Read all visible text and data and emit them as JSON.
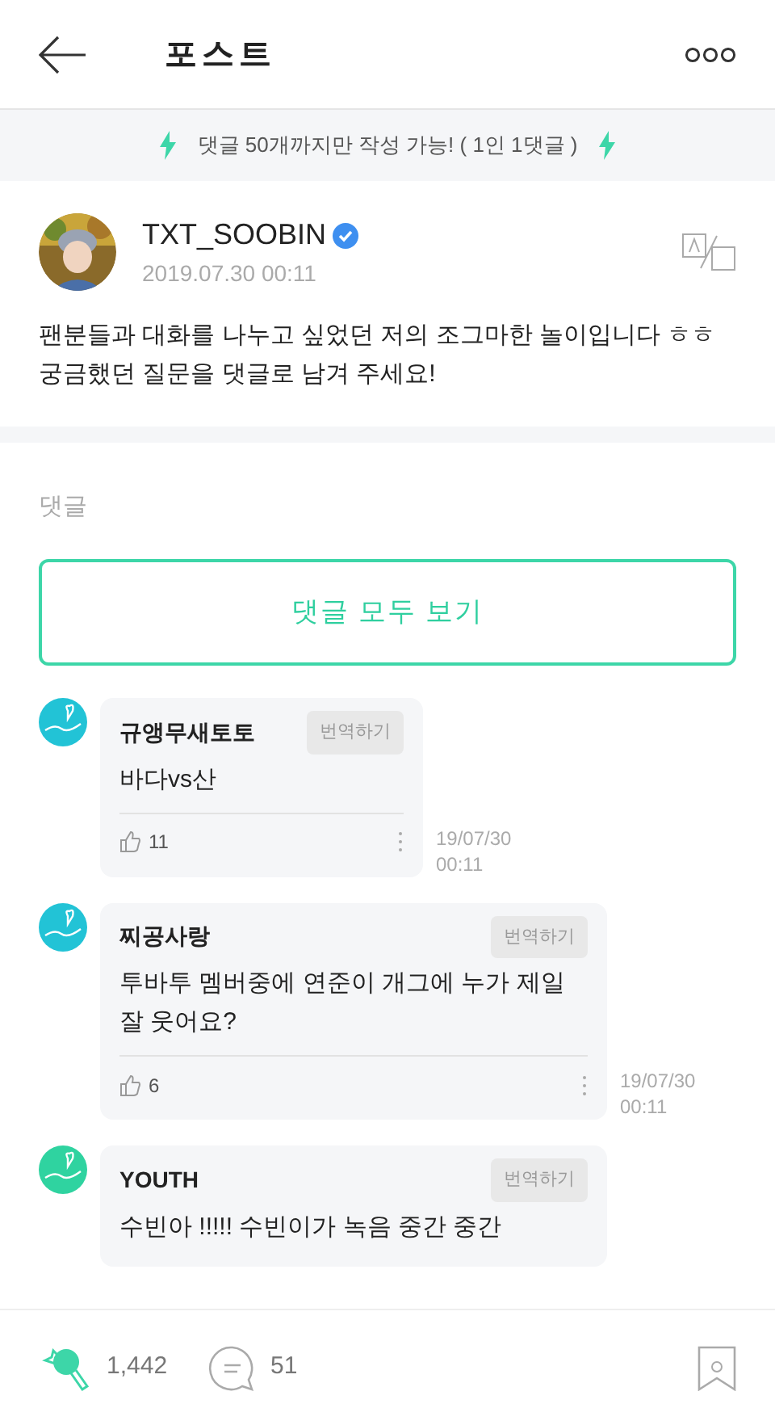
{
  "header": {
    "title": "포스트"
  },
  "notice": {
    "text": "댓글 50개까지만 작성 가능! ( 1인 1댓글 )"
  },
  "post": {
    "author": "TXT_SOOBIN",
    "verified": true,
    "date": "2019.07.30 00:11",
    "body": "팬분들과 대화를 나누고 싶었던 저의 조그마한 놀이입니다 ㅎㅎ 궁금했던 질문을 댓글로 남겨 주세요!"
  },
  "comments_section": {
    "label": "댓글",
    "view_all": "댓글 모두 보기"
  },
  "comments": [
    {
      "author": "규앵무새토토",
      "translate": "번역하기",
      "text": "바다vs산",
      "likes": "11",
      "date": "19/07/30",
      "time": "00:11"
    },
    {
      "author": "찌공사랑",
      "translate": "번역하기",
      "text": "투바투 멤버중에 연준이 개그에 누가 제일 잘 웃어요?",
      "likes": "6",
      "date": "19/07/30",
      "time": "00:11"
    },
    {
      "author": "YOUTH",
      "translate": "번역하기",
      "text": "수빈아 !!!!! 수빈이가 녹음 중간 중간"
    }
  ],
  "bottom_bar": {
    "cheers": "1,442",
    "comments": "51"
  }
}
